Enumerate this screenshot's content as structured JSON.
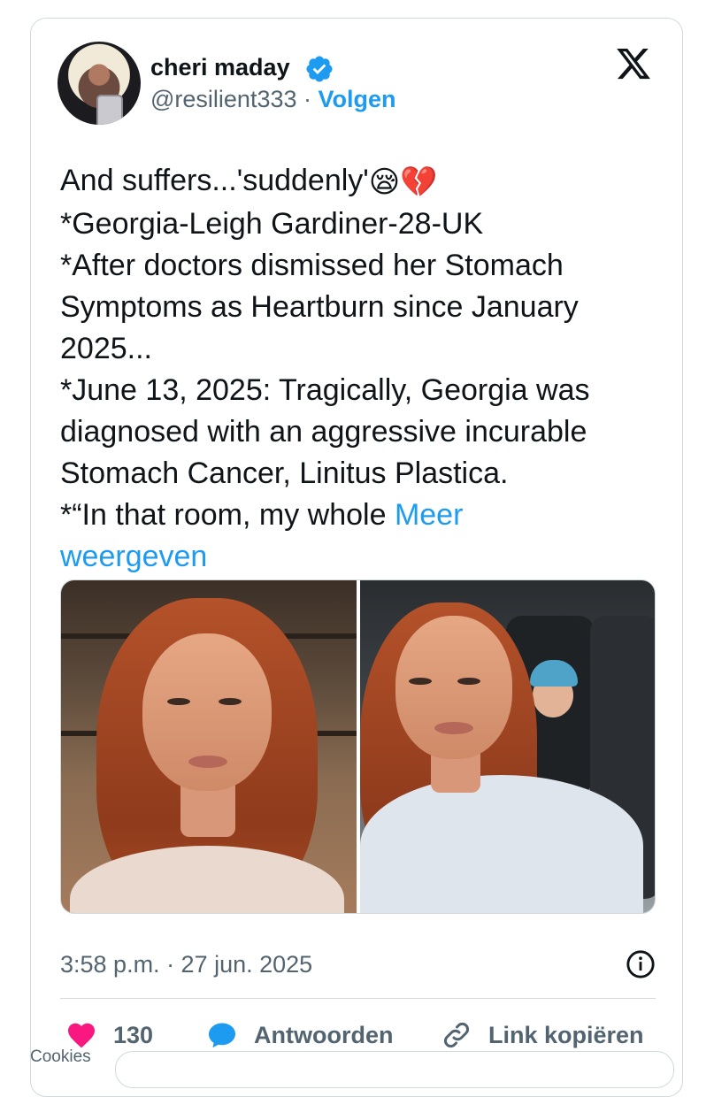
{
  "author": {
    "display_name": "cheri maday",
    "handle": "@resilient333",
    "separator": "·",
    "follow_label": "Volgen",
    "verified_icon": "verified-badge-icon"
  },
  "platform_icon": "x-logo-icon",
  "tweet": {
    "lines": [
      "And suffers...'suddenly'",
      "*Georgia-Leigh Gardiner-28-UK",
      "*After doctors dismissed her Stomach",
      "Symptoms  as Heartburn since January",
      "2025...",
      "*June 13, 2025: Tragically, Georgia was",
      "diagnosed with an aggressive incurable",
      "Stomach Cancer, Linitus Plastica.",
      "*“In that room, my whole"
    ],
    "emoji_1": "😪",
    "emoji_2": "💔",
    "more_link": "Meer",
    "more_link_2": "weergeven"
  },
  "media": {
    "photo_count": 2
  },
  "meta": {
    "timestamp": "3:58 p.m. · 27 jun. 2025",
    "info_icon": "info-icon"
  },
  "actions": {
    "like_count": "130",
    "reply_label": "Antwoorden",
    "copy_label": "Link kopiëren"
  },
  "cookies_label": "Cookies",
  "colors": {
    "accent": "#1d9bf0",
    "like": "#f91880",
    "muted": "#536471",
    "text": "#0f1419",
    "border": "#cfd9de"
  }
}
